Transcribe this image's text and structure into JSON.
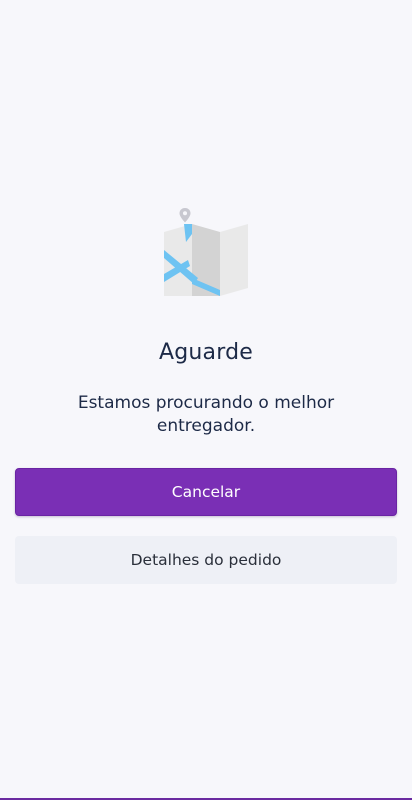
{
  "illustration": {
    "icon": "folded-map-with-pin-icon",
    "colors": {
      "route": "#6ec3f2",
      "panel_light": "#eaeaea",
      "panel_dark": "#d2d2d2",
      "pin": "#c8c8d0"
    }
  },
  "status": {
    "title": "Aguarde",
    "message": "Estamos procurando o melhor entregador."
  },
  "actions": {
    "cancel_label": "Cancelar",
    "details_label": "Detalhes do pedido"
  },
  "colors": {
    "background": "#f7f7fb",
    "primary": "#7a2fb5",
    "secondary_bg": "#eef0f6",
    "text": "#1d2a47"
  }
}
